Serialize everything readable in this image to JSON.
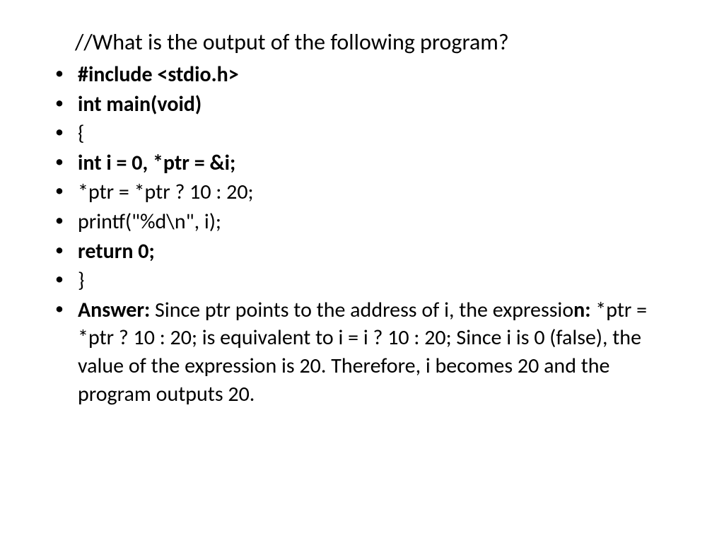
{
  "title": "//What is the output of the following program?",
  "lines": {
    "l1": "#include <stdio.h>",
    "l2": "int main(void)",
    "l3": "{",
    "l4": "int i = 0, *ptr = &i;",
    "l5": "*ptr = *ptr ? 10 : 20;",
    "l6": "printf(\"%d\\n\", i);",
    "l7": "return 0;",
    "l8": "}"
  },
  "answer": {
    "label": "Answer:",
    "part1": " Since ptr points to the address of i, the expressio",
    "boldn": "n:",
    "part2": " *ptr = *ptr ? 10 : 20; is equivalent to i = i ? 10 : 20; Since i is 0 (false), the value of the expression is 20. Therefore, i becomes 20 and the program outputs 20."
  }
}
